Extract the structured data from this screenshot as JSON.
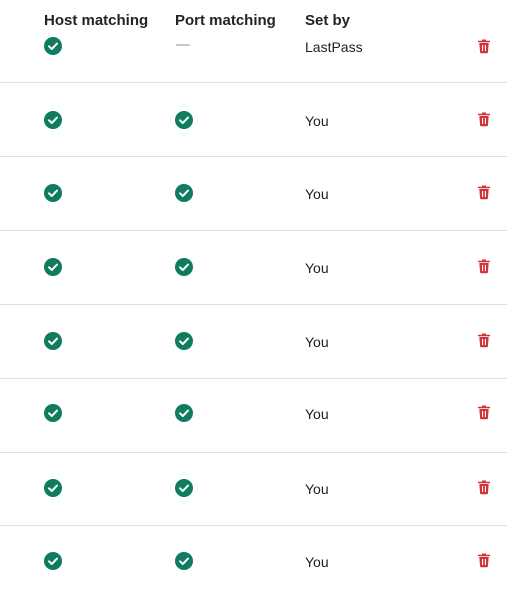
{
  "columns": {
    "host": "Host matching",
    "port": "Port matching",
    "set_by": "Set by"
  },
  "colors": {
    "check": "#0f7b5f",
    "delete": "#d13438",
    "divider": "#e0e0e0",
    "dash": "#c8c8c8"
  },
  "rows": [
    {
      "host": "check-icon",
      "port": "dash-icon",
      "set_by": "LastPass"
    },
    {
      "host": "check-icon",
      "port": "check-icon",
      "set_by": "You"
    },
    {
      "host": "check-icon",
      "port": "check-icon",
      "set_by": "You"
    },
    {
      "host": "check-icon",
      "port": "check-icon",
      "set_by": "You"
    },
    {
      "host": "check-icon",
      "port": "check-icon",
      "set_by": "You"
    },
    {
      "host": "check-icon",
      "port": "check-icon",
      "set_by": "You"
    },
    {
      "host": "check-icon",
      "port": "check-icon",
      "set_by": "You"
    },
    {
      "host": "check-icon",
      "port": "check-icon",
      "set_by": "You"
    }
  ]
}
